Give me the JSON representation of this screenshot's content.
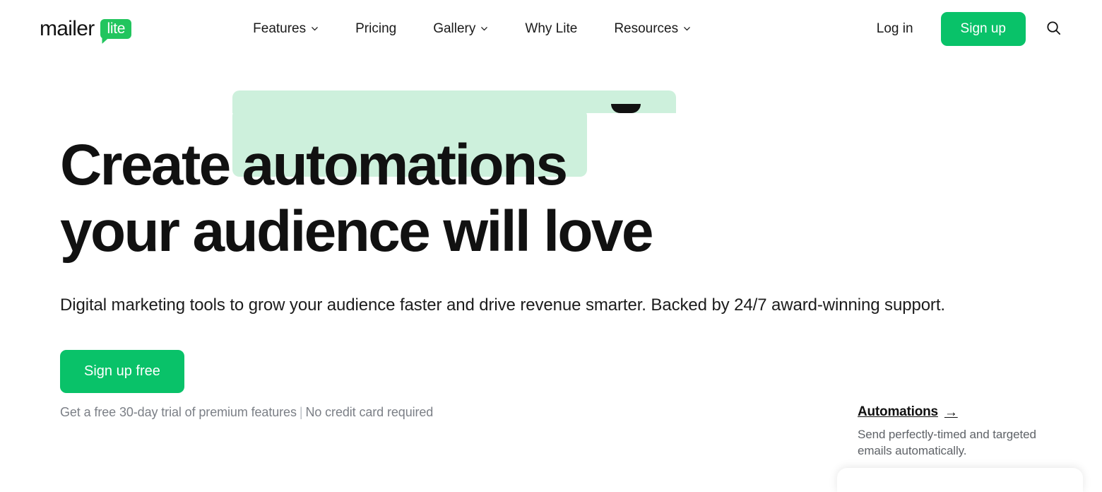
{
  "brand": {
    "name_primary": "mailer",
    "name_badge": "lite",
    "accent_green": "#09C269",
    "logo_green": "#22C55E",
    "highlight_mint": "#CDF0DC",
    "text_dark": "#111111",
    "text_muted": "#7b7f86"
  },
  "header": {
    "nav_items": [
      {
        "label": "Features",
        "has_dropdown": true
      },
      {
        "label": "Pricing",
        "has_dropdown": false
      },
      {
        "label": "Gallery",
        "has_dropdown": true
      },
      {
        "label": "Why Lite",
        "has_dropdown": false
      },
      {
        "label": "Resources",
        "has_dropdown": true
      }
    ],
    "login_label": "Log in",
    "signup_label": "Sign up",
    "search_icon": "search-icon",
    "dropdown_icon": "chevron-down-icon"
  },
  "hero": {
    "heading_line1_prefix": "Create",
    "heading_rotating_word": "automations",
    "heading_line2": "your audience will love",
    "subheading": "Digital marketing tools to grow your audience faster and drive revenue smarter. Backed by 24/7 award-winning support.",
    "cta_label": "Sign up free",
    "fineprint_left": "Get a free 30-day trial of premium features",
    "fineprint_separator": "|",
    "fineprint_right": "No credit card required"
  },
  "feature_card": {
    "title": "Automations",
    "arrow": "→",
    "description": "Send perfectly-timed and targeted emails automatically."
  }
}
